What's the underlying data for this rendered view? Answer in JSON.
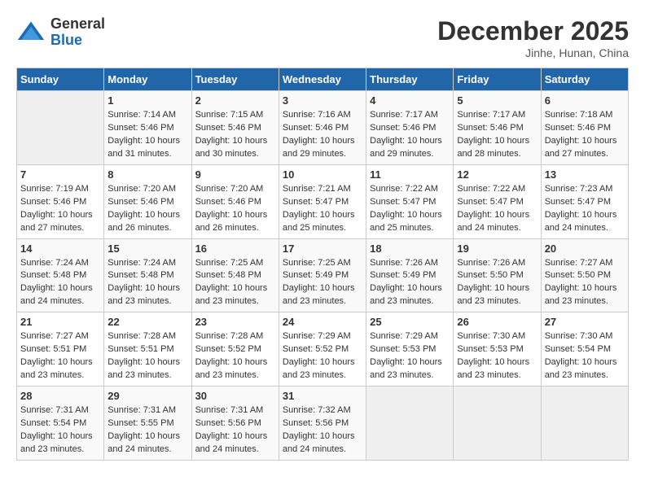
{
  "header": {
    "logo_line1": "General",
    "logo_line2": "Blue",
    "month": "December 2025",
    "location": "Jinhe, Hunan, China"
  },
  "days_of_week": [
    "Sunday",
    "Monday",
    "Tuesday",
    "Wednesday",
    "Thursday",
    "Friday",
    "Saturday"
  ],
  "weeks": [
    [
      {
        "day": "",
        "info": ""
      },
      {
        "day": "1",
        "info": "Sunrise: 7:14 AM\nSunset: 5:46 PM\nDaylight: 10 hours\nand 31 minutes."
      },
      {
        "day": "2",
        "info": "Sunrise: 7:15 AM\nSunset: 5:46 PM\nDaylight: 10 hours\nand 30 minutes."
      },
      {
        "day": "3",
        "info": "Sunrise: 7:16 AM\nSunset: 5:46 PM\nDaylight: 10 hours\nand 29 minutes."
      },
      {
        "day": "4",
        "info": "Sunrise: 7:17 AM\nSunset: 5:46 PM\nDaylight: 10 hours\nand 29 minutes."
      },
      {
        "day": "5",
        "info": "Sunrise: 7:17 AM\nSunset: 5:46 PM\nDaylight: 10 hours\nand 28 minutes."
      },
      {
        "day": "6",
        "info": "Sunrise: 7:18 AM\nSunset: 5:46 PM\nDaylight: 10 hours\nand 27 minutes."
      }
    ],
    [
      {
        "day": "7",
        "info": "Sunrise: 7:19 AM\nSunset: 5:46 PM\nDaylight: 10 hours\nand 27 minutes."
      },
      {
        "day": "8",
        "info": "Sunrise: 7:20 AM\nSunset: 5:46 PM\nDaylight: 10 hours\nand 26 minutes."
      },
      {
        "day": "9",
        "info": "Sunrise: 7:20 AM\nSunset: 5:46 PM\nDaylight: 10 hours\nand 26 minutes."
      },
      {
        "day": "10",
        "info": "Sunrise: 7:21 AM\nSunset: 5:47 PM\nDaylight: 10 hours\nand 25 minutes."
      },
      {
        "day": "11",
        "info": "Sunrise: 7:22 AM\nSunset: 5:47 PM\nDaylight: 10 hours\nand 25 minutes."
      },
      {
        "day": "12",
        "info": "Sunrise: 7:22 AM\nSunset: 5:47 PM\nDaylight: 10 hours\nand 24 minutes."
      },
      {
        "day": "13",
        "info": "Sunrise: 7:23 AM\nSunset: 5:47 PM\nDaylight: 10 hours\nand 24 minutes."
      }
    ],
    [
      {
        "day": "14",
        "info": "Sunrise: 7:24 AM\nSunset: 5:48 PM\nDaylight: 10 hours\nand 24 minutes."
      },
      {
        "day": "15",
        "info": "Sunrise: 7:24 AM\nSunset: 5:48 PM\nDaylight: 10 hours\nand 23 minutes."
      },
      {
        "day": "16",
        "info": "Sunrise: 7:25 AM\nSunset: 5:48 PM\nDaylight: 10 hours\nand 23 minutes."
      },
      {
        "day": "17",
        "info": "Sunrise: 7:25 AM\nSunset: 5:49 PM\nDaylight: 10 hours\nand 23 minutes."
      },
      {
        "day": "18",
        "info": "Sunrise: 7:26 AM\nSunset: 5:49 PM\nDaylight: 10 hours\nand 23 minutes."
      },
      {
        "day": "19",
        "info": "Sunrise: 7:26 AM\nSunset: 5:50 PM\nDaylight: 10 hours\nand 23 minutes."
      },
      {
        "day": "20",
        "info": "Sunrise: 7:27 AM\nSunset: 5:50 PM\nDaylight: 10 hours\nand 23 minutes."
      }
    ],
    [
      {
        "day": "21",
        "info": "Sunrise: 7:27 AM\nSunset: 5:51 PM\nDaylight: 10 hours\nand 23 minutes."
      },
      {
        "day": "22",
        "info": "Sunrise: 7:28 AM\nSunset: 5:51 PM\nDaylight: 10 hours\nand 23 minutes."
      },
      {
        "day": "23",
        "info": "Sunrise: 7:28 AM\nSunset: 5:52 PM\nDaylight: 10 hours\nand 23 minutes."
      },
      {
        "day": "24",
        "info": "Sunrise: 7:29 AM\nSunset: 5:52 PM\nDaylight: 10 hours\nand 23 minutes."
      },
      {
        "day": "25",
        "info": "Sunrise: 7:29 AM\nSunset: 5:53 PM\nDaylight: 10 hours\nand 23 minutes."
      },
      {
        "day": "26",
        "info": "Sunrise: 7:30 AM\nSunset: 5:53 PM\nDaylight: 10 hours\nand 23 minutes."
      },
      {
        "day": "27",
        "info": "Sunrise: 7:30 AM\nSunset: 5:54 PM\nDaylight: 10 hours\nand 23 minutes."
      }
    ],
    [
      {
        "day": "28",
        "info": "Sunrise: 7:31 AM\nSunset: 5:54 PM\nDaylight: 10 hours\nand 23 minutes."
      },
      {
        "day": "29",
        "info": "Sunrise: 7:31 AM\nSunset: 5:55 PM\nDaylight: 10 hours\nand 24 minutes."
      },
      {
        "day": "30",
        "info": "Sunrise: 7:31 AM\nSunset: 5:56 PM\nDaylight: 10 hours\nand 24 minutes."
      },
      {
        "day": "31",
        "info": "Sunrise: 7:32 AM\nSunset: 5:56 PM\nDaylight: 10 hours\nand 24 minutes."
      },
      {
        "day": "",
        "info": ""
      },
      {
        "day": "",
        "info": ""
      },
      {
        "day": "",
        "info": ""
      }
    ]
  ]
}
